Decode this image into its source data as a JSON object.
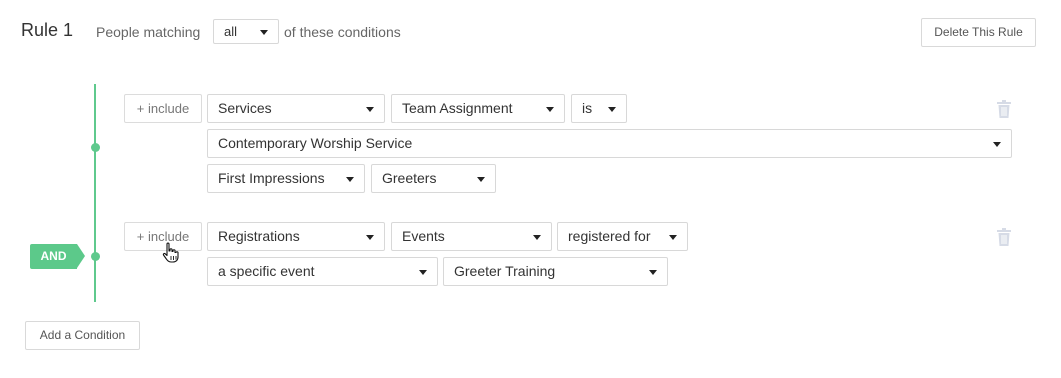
{
  "rule": {
    "title": "Rule 1",
    "people_matching": "People matching",
    "match_value": "all",
    "of_conditions": "of these conditions",
    "delete_label": "Delete This Rule"
  },
  "connector": {
    "label": "AND",
    "color": "#5cc98a"
  },
  "conditions": [
    {
      "include_label": "+ include",
      "category": "Services",
      "field": "Team Assignment",
      "operator": "is",
      "value": "Contemporary Worship Service",
      "sub_value_1": "First Impressions",
      "sub_value_2": "Greeters",
      "delete_icon": "trash-icon"
    },
    {
      "include_label": "+ include",
      "category": "Registrations",
      "field": "Events",
      "operator": "registered for",
      "qualifier": "a specific event",
      "value": "Greeter Training",
      "delete_icon": "trash-icon"
    }
  ],
  "footer": {
    "add_condition_label": "Add a Condition"
  }
}
